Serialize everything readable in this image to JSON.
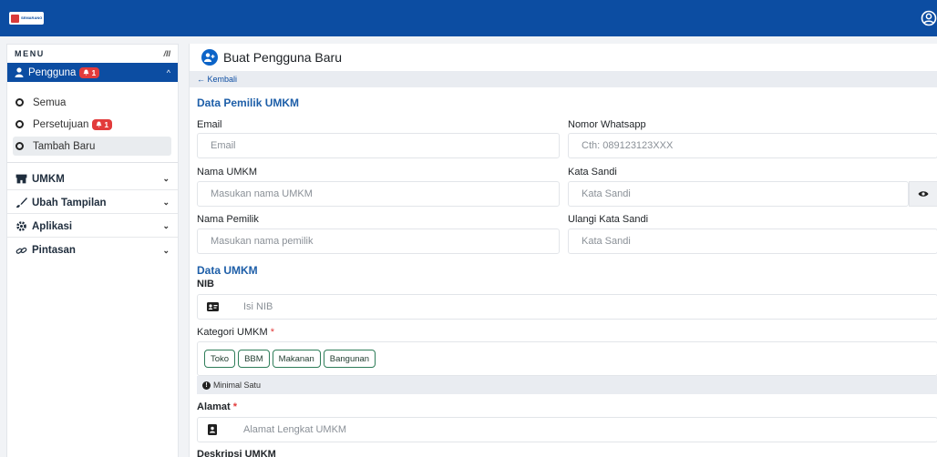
{
  "topbar": {
    "logo_text": "SEMARANG",
    "user_icon": "user-circle-icon",
    "bg_color": "#0c4da2"
  },
  "sidebar": {
    "menu_label": "MENU",
    "collapse_icon": "collapse-icon",
    "users": {
      "label": "Pengguna",
      "badge": "1",
      "icon": "user-icon",
      "sub_items": [
        {
          "label": "Semua"
        },
        {
          "label": "Persetujuan",
          "badge": "1"
        },
        {
          "label": "Tambah Baru",
          "selected": true
        }
      ]
    },
    "nav_items": [
      {
        "label": "UMKM",
        "icon": "store-icon"
      },
      {
        "label": "Ubah Tampilan",
        "icon": "brush-icon"
      },
      {
        "label": "Aplikasi",
        "icon": "cog-icon"
      },
      {
        "label": "Pintasan",
        "icon": "link-icon"
      }
    ]
  },
  "main": {
    "title": "Buat Pengguna Baru",
    "back_label": "← Kembali",
    "owner_section": {
      "title": "Data Pemilik UMKM",
      "email": {
        "label": "Email",
        "placeholder": "Email"
      },
      "whatsapp": {
        "label": "Nomor Whatsapp",
        "placeholder": "Cth: 089123123XXX"
      },
      "umkm_name": {
        "label": "Nama UMKM",
        "placeholder": "Masukan nama UMKM"
      },
      "password": {
        "label": "Kata Sandi",
        "placeholder": "Kata Sandi"
      },
      "owner_name": {
        "label": "Nama Pemilik",
        "placeholder": "Masukan nama pemilik"
      },
      "password_repeat": {
        "label": "Ulangi Kata Sandi",
        "placeholder": "Kata Sandi"
      }
    },
    "umkm_section": {
      "title": "Data UMKM",
      "nib": {
        "label": "NIB",
        "placeholder": "Isi NIB"
      },
      "category": {
        "label": "Kategori UMKM",
        "required_mark": "*",
        "options": [
          "Toko",
          "BBM",
          "Makanan",
          "Bangunan"
        ],
        "hint": "Minimal Satu"
      },
      "address": {
        "label": "Alamat",
        "required_mark": "*",
        "placeholder": "Alamat Lengkat UMKM"
      },
      "description": {
        "label": "Deskripsi UMKM"
      }
    }
  },
  "colors": {
    "primary": "#0c4da2",
    "section_title": "#1d5ea8",
    "badge": "#e23b3b",
    "chip_border": "#2e7d59"
  }
}
